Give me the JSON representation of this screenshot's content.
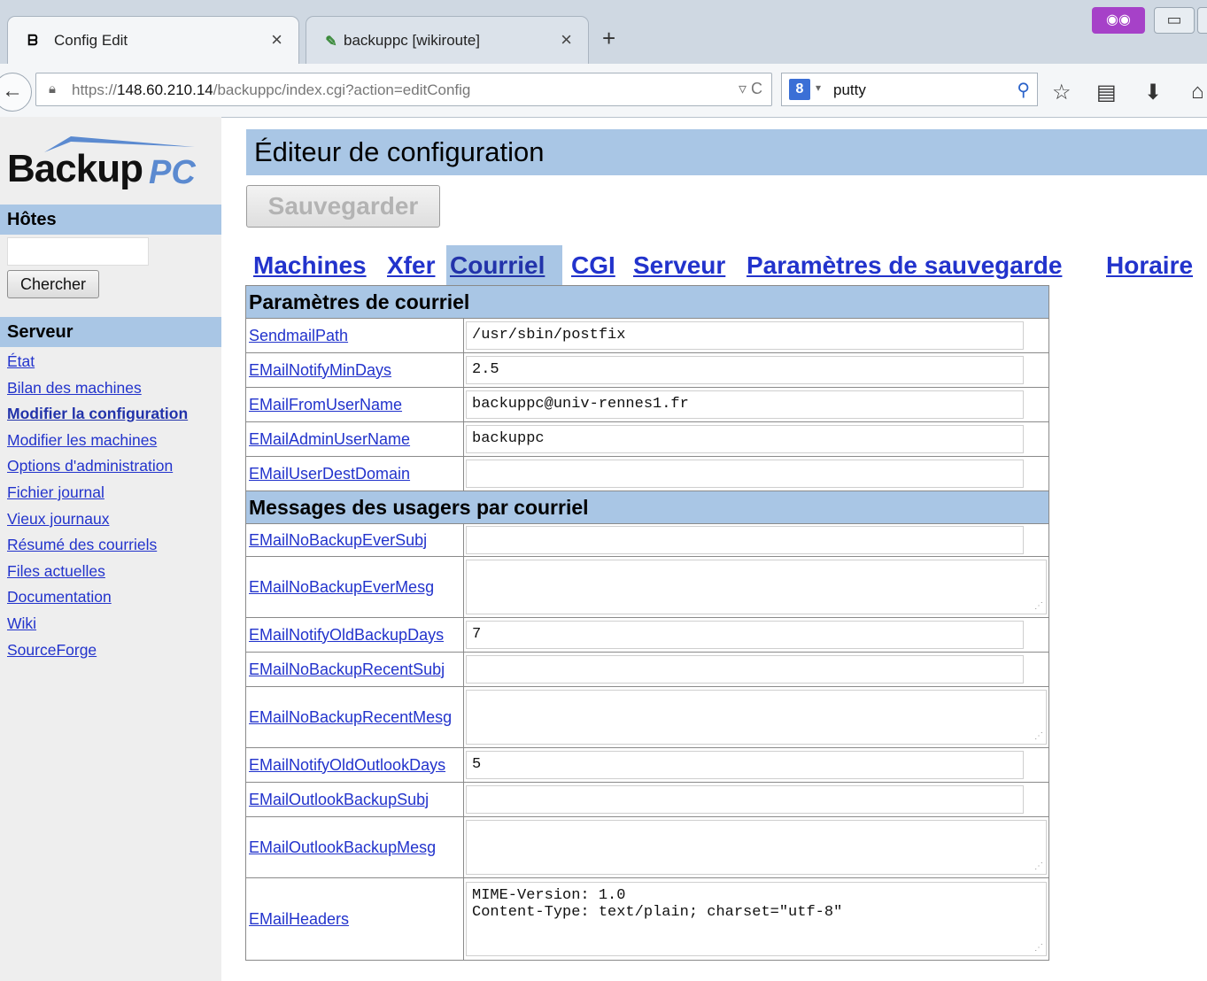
{
  "browser": {
    "tabs": [
      {
        "title": "Config Edit",
        "icon": "backuppc-favicon",
        "active": true
      },
      {
        "title": "backuppc [wikiroute]",
        "icon": "wiki-favicon",
        "active": false
      }
    ],
    "new_tab": "+",
    "close_glyph": "×",
    "url_prefix": "https://",
    "url_host": "148.60.210.14",
    "url_path": "/backuppc/index.cgi?action=editConfig",
    "search_value": "putty",
    "search_engine": "8"
  },
  "sidebar": {
    "logo_main": "Backup",
    "logo_pc": "PC",
    "hosts_heading": "Hôtes",
    "search_button": "Chercher",
    "server_heading": "Serveur",
    "links": [
      {
        "label": "État"
      },
      {
        "label": "Bilan des machines"
      },
      {
        "label": "Modifier la configuration",
        "current": true
      },
      {
        "label": "Modifier les machines"
      },
      {
        "label": "Options d'administration"
      },
      {
        "label": "Fichier journal"
      },
      {
        "label": "Vieux journaux"
      },
      {
        "label": "Résumé des courriels"
      },
      {
        "label": "Files actuelles"
      },
      {
        "label": "Documentation"
      },
      {
        "label": "Wiki"
      },
      {
        "label": "SourceForge"
      }
    ]
  },
  "main": {
    "title": "Éditeur de configuration",
    "save_button": "Sauvegarder",
    "tabs": [
      {
        "label": "Machines"
      },
      {
        "label": "Xfer"
      },
      {
        "label": "Courriel",
        "selected": true
      },
      {
        "label": "CGI"
      },
      {
        "label": "Serveur"
      },
      {
        "label": "Paramètres de sauvegarde"
      },
      {
        "label": "Horaire"
      }
    ],
    "section1": "Paramètres de courriel",
    "section2": "Messages des usagers par courriel",
    "fields": {
      "SendmailPath": "/usr/sbin/postfix",
      "EMailNotifyMinDays": "2.5",
      "EMailFromUserName": "backuppc@univ-rennes1.fr",
      "EMailAdminUserName": "backuppc",
      "EMailUserDestDomain": "",
      "EMailNoBackupEverSubj": "",
      "EMailNoBackupEverMesg": "",
      "EMailNotifyOldBackupDays": "7",
      "EMailNoBackupRecentSubj": "",
      "EMailNoBackupRecentMesg": "",
      "EMailNotifyOldOutlookDays": "5",
      "EMailOutlookBackupSubj": "",
      "EMailOutlookBackupMesg": "",
      "EMailHeaders": "MIME-Version: 1.0\nContent-Type: text/plain; charset=\"utf-8\""
    },
    "keys": [
      "SendmailPath",
      "EMailNotifyMinDays",
      "EMailFromUserName",
      "EMailAdminUserName",
      "EMailUserDestDomain",
      "EMailNoBackupEverSubj",
      "EMailNoBackupEverMesg",
      "EMailNotifyOldBackupDays",
      "EMailNoBackupRecentSubj",
      "EMailNoBackupRecentMesg",
      "EMailNotifyOldOutlookDays",
      "EMailOutlookBackupSubj",
      "EMailOutlookBackupMesg",
      "EMailHeaders"
    ]
  },
  "colors": {
    "header_blue": "#a9c6e5",
    "link": "#2233cc",
    "sidebar_bg": "#eeeeee"
  }
}
